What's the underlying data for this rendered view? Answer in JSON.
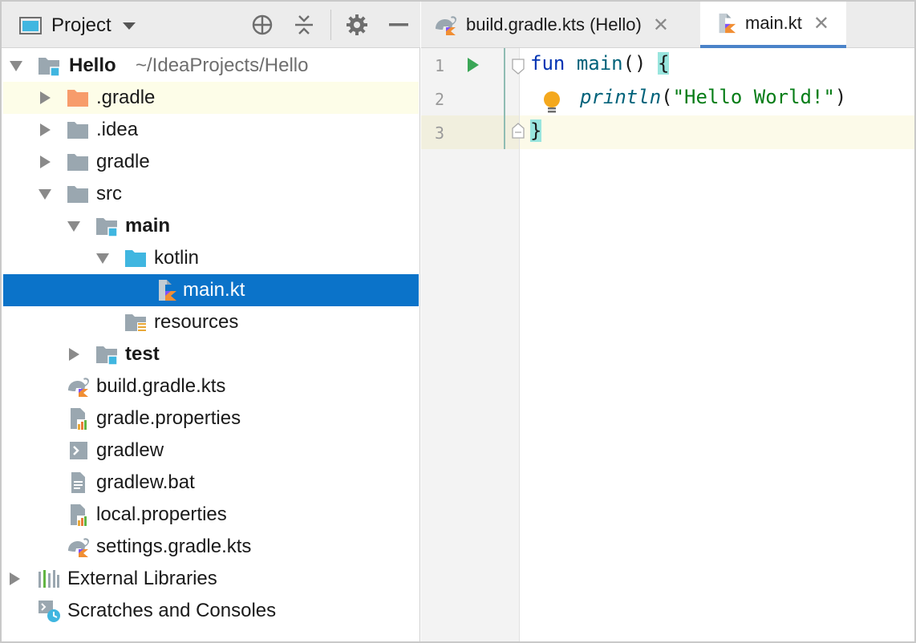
{
  "project_panel": {
    "title": "Project",
    "icons": [
      "target-icon",
      "collapse-all-icon",
      "gear-icon",
      "minimize-icon"
    ]
  },
  "tree": {
    "root_name": "Hello",
    "root_path": "~/IdeaProjects/Hello",
    "items": [
      {
        "label": ".gradle"
      },
      {
        "label": ".idea"
      },
      {
        "label": "gradle"
      },
      {
        "label": "src"
      },
      {
        "label": "main"
      },
      {
        "label": "kotlin"
      },
      {
        "label": "main.kt"
      },
      {
        "label": "resources"
      },
      {
        "label": "test"
      },
      {
        "label": "build.gradle.kts"
      },
      {
        "label": "gradle.properties"
      },
      {
        "label": "gradlew"
      },
      {
        "label": "gradlew.bat"
      },
      {
        "label": "local.properties"
      },
      {
        "label": "settings.gradle.kts"
      },
      {
        "label": "External Libraries"
      },
      {
        "label": "Scratches and Consoles"
      }
    ]
  },
  "editor": {
    "tabs": [
      {
        "label": "build.gradle.kts (Hello)",
        "active": false
      },
      {
        "label": "main.kt",
        "active": true
      }
    ],
    "close_glyph": "✕",
    "line_numbers": [
      "1",
      "2",
      "3"
    ],
    "code": {
      "l1_kw": "fun",
      "l1_fn": "main",
      "l1_rest": "() ",
      "l1_brace": "{",
      "l2_fn": "println",
      "l2_open": "(",
      "l2_str": "\"Hello World!\"",
      "l2_close": ")",
      "l3_brace": "}"
    }
  },
  "colors": {
    "selection": "#0b73c9",
    "kotlin_orange": "#f18e33",
    "folder_gray": "#9aa7b0",
    "folder_blue": "#40b6e0",
    "run_green": "#3aa656"
  }
}
